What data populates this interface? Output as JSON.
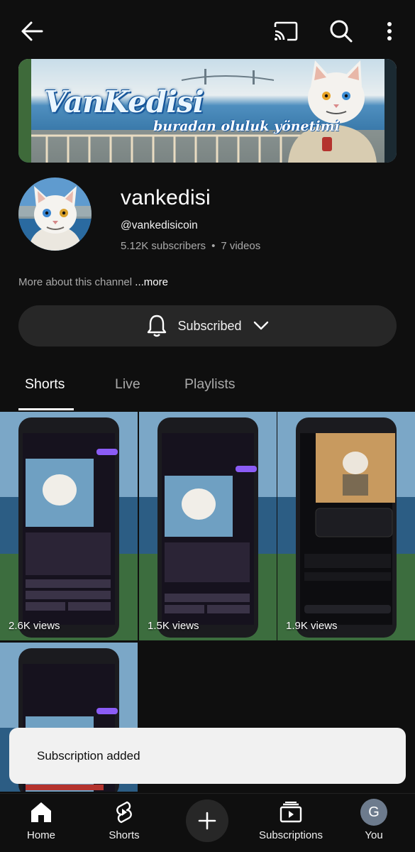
{
  "topbar": {
    "back_icon": "arrow-left-icon",
    "cast_icon": "cast-icon",
    "search_icon": "search-icon",
    "more_icon": "more-vertical-icon"
  },
  "banner": {
    "title": "VanKedisi",
    "subtitle": "buradan oluluk yönetimi"
  },
  "channel": {
    "name": "vankedisi",
    "handle": "@vankedisicoin",
    "subscribers": "5.12K subscribers",
    "separator": "•",
    "videos": "7 videos",
    "about_text": "More about this channel",
    "about_more": "...more"
  },
  "subscribe_button": {
    "label": "Subscribed",
    "bell_icon": "bell-icon",
    "chevron_icon": "chevron-down-icon"
  },
  "tabs": [
    {
      "label": "Shorts",
      "selected": true
    },
    {
      "label": "Live",
      "selected": false
    },
    {
      "label": "Playlists",
      "selected": false
    }
  ],
  "shorts": [
    {
      "views": "2.6K views"
    },
    {
      "views": "1.5K views"
    },
    {
      "views": "1.9K views"
    },
    {
      "views": ""
    }
  ],
  "toast": {
    "message": "Subscription added"
  },
  "bottom_nav": [
    {
      "label": "Home",
      "icon": "home-icon"
    },
    {
      "label": "Shorts",
      "icon": "shorts-icon"
    },
    {
      "label": "",
      "icon": "plus-icon"
    },
    {
      "label": "Subscriptions",
      "icon": "subscriptions-icon"
    },
    {
      "label": "You",
      "icon": "avatar",
      "avatar_letter": "G"
    }
  ],
  "colors": {
    "background": "#0f0f0f",
    "button_bg": "#272727",
    "secondary_text": "#aaaaaa",
    "toast_bg": "#f1f1f1",
    "avatar_bg": "#6d7b8d"
  }
}
